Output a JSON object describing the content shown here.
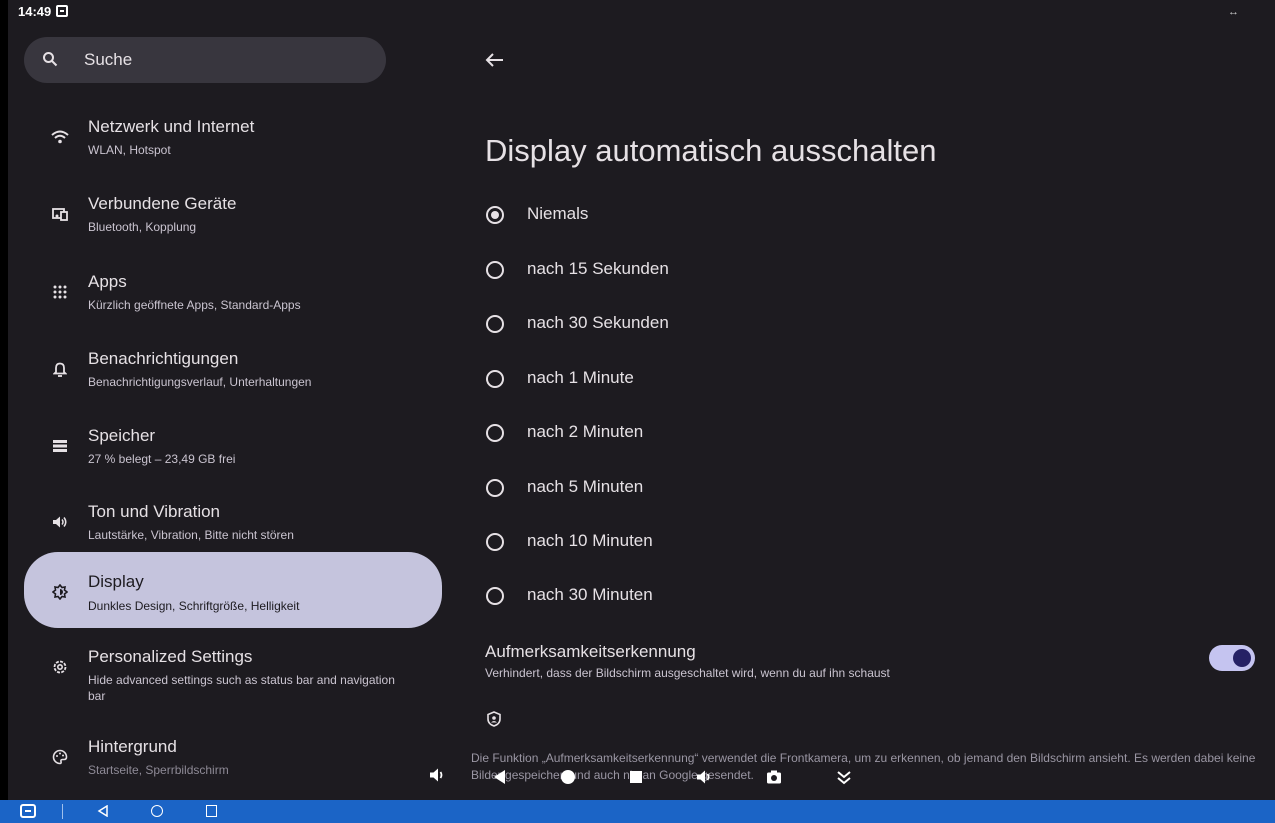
{
  "status": {
    "time": "14:49"
  },
  "search": {
    "placeholder": "Suche"
  },
  "sidebar": {
    "items": [
      {
        "title": "Netzwerk und Internet",
        "subtitle": "WLAN, Hotspot",
        "icon": "wifi-icon"
      },
      {
        "title": "Verbundene Geräte",
        "subtitle": "Bluetooth, Kopplung",
        "icon": "connected-devices-icon"
      },
      {
        "title": "Apps",
        "subtitle": "Kürzlich geöffnete Apps, Standard-Apps",
        "icon": "apps-grid-icon"
      },
      {
        "title": "Benachrichtigungen",
        "subtitle": "Benachrichtigungsverlauf, Unterhaltungen",
        "icon": "bell-icon"
      },
      {
        "title": "Speicher",
        "subtitle": "27 % belegt – 23,49 GB frei",
        "icon": "storage-icon"
      },
      {
        "title": "Ton und Vibration",
        "subtitle": "Lautstärke, Vibration, Bitte nicht stören",
        "icon": "volume-icon"
      },
      {
        "title": "Display",
        "subtitle": "Dunkles Design, Schriftgröße, Helligkeit",
        "icon": "display-icon",
        "active": true
      },
      {
        "title": "Personalized Settings",
        "subtitle": "Hide advanced settings such as status bar and navigation bar",
        "icon": "gear-icon"
      },
      {
        "title": "Hintergrund",
        "subtitle": "Startseite, Sperrbildschirm",
        "icon": "palette-icon"
      }
    ]
  },
  "main": {
    "title": "Display automatisch ausschalten",
    "options": [
      {
        "label": "Niemals",
        "selected": true
      },
      {
        "label": "nach 15 Sekunden",
        "selected": false
      },
      {
        "label": "nach 30 Sekunden",
        "selected": false
      },
      {
        "label": "nach 1 Minute",
        "selected": false
      },
      {
        "label": "nach 2 Minuten",
        "selected": false
      },
      {
        "label": "nach 5 Minuten",
        "selected": false
      },
      {
        "label": "nach 10 Minuten",
        "selected": false
      },
      {
        "label": "nach 30 Minuten",
        "selected": false
      }
    ],
    "attention": {
      "title": "Aufmerksamkeitserkennung",
      "description": "Verhindert, dass der Bildschirm ausgeschaltet wird, wenn du auf ihn schaust",
      "enabled": true
    },
    "footnote": "Die Funktion „Aufmerksamkeitserkennung“ verwendet die Frontkamera, um zu erkennen, ob jemand den Bildschirm ansieht. Es werden dabei keine Bilder gespeichert und auch nie an Google gesendet."
  },
  "colors": {
    "background": "#1d1b20",
    "active_item": "#c5c4dd",
    "toggle_track": "#c5c4f0",
    "taskbar": "#1b64c6"
  }
}
